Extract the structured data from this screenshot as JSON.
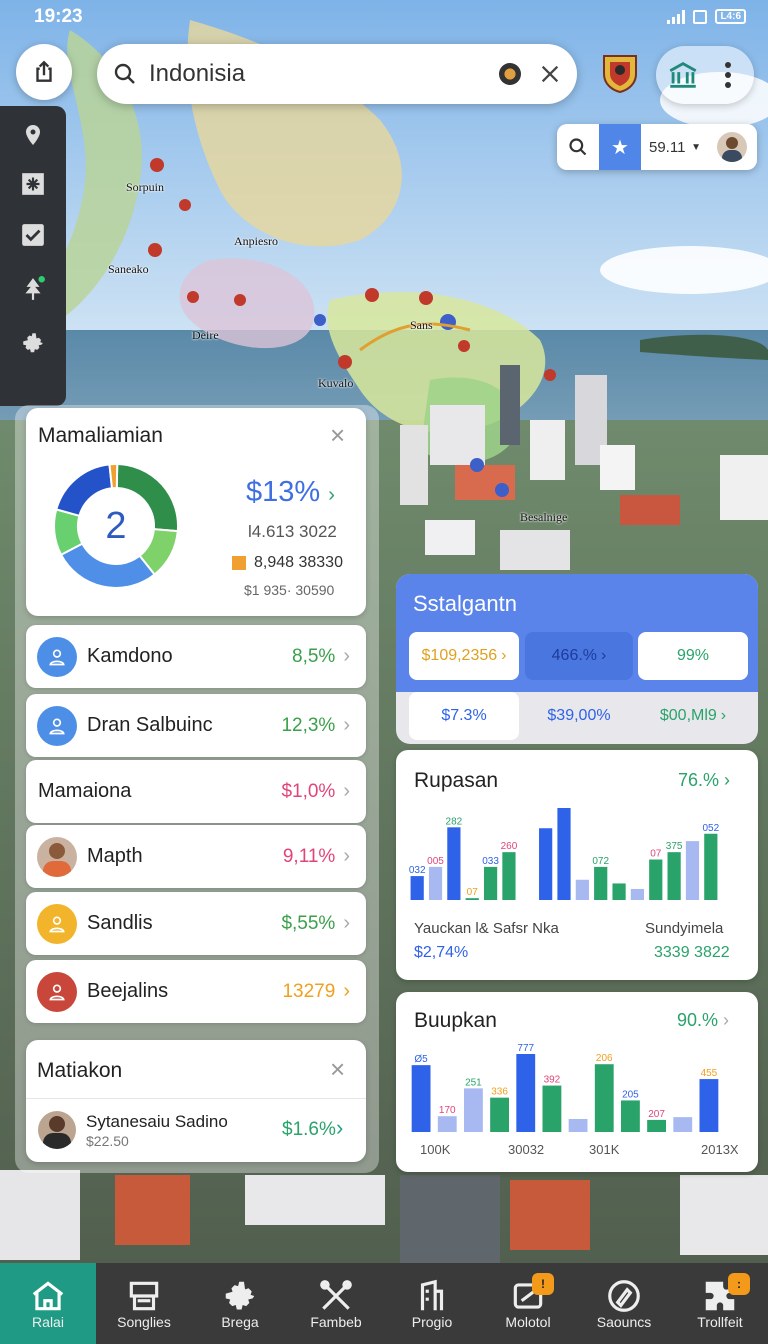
{
  "status": {
    "time": "19:23",
    "battery": "L4:6"
  },
  "search": {
    "value": "Indonisia"
  },
  "mini_toolbar": {
    "value": "59.11"
  },
  "map_labels": [
    "Sorpuin",
    "Anpiesro",
    "Saneako",
    "Deire",
    "Sans",
    "Kuvalo",
    "Besalnige"
  ],
  "summary_card": {
    "title": "Mamaliamian",
    "donut_center": "2",
    "percent": "$13%",
    "line1": "l4.613 3022",
    "line2": "8,948 38330",
    "line3": "$1 935· 30590"
  },
  "donut": {
    "segments": [
      {
        "value": 26,
        "color": "#2f8f4a"
      },
      {
        "value": 13,
        "color": "#7fd26a"
      },
      {
        "value": 28,
        "color": "#4f8fe8"
      },
      {
        "value": 12,
        "color": "#69d06f"
      },
      {
        "value": 19,
        "color": "#2452c8"
      },
      {
        "value": 2,
        "color": "#f0a030"
      }
    ]
  },
  "rows": [
    {
      "name": "Kamdono",
      "value": "8,5%",
      "color": "#3aa04a"
    },
    {
      "name": "Dran Salbuinc",
      "value": "12,3%",
      "color": "#3aa04a"
    },
    {
      "name": "Mamaiona",
      "value": "$1,0%",
      "color": "#e0457a"
    },
    {
      "name": "Mapth",
      "value": "9,11%",
      "color": "#e0457a"
    },
    {
      "name": "Sandlis",
      "value": "$,55%",
      "color": "#3aa04a"
    },
    {
      "name": "Beejalins",
      "value": "13279",
      "color": "#f0a020"
    }
  ],
  "bottom_card": {
    "title": "Matiakon",
    "person_name": "Sytanesaiu Sadino",
    "person_sub": "$22.50",
    "value": "$1.6%"
  },
  "stats": {
    "title": "Sstalgantn",
    "row1": [
      "$109,2356",
      "466.%",
      "99%"
    ],
    "row2": [
      "$7.3%",
      "$39,00%",
      "$00,Ml9"
    ]
  },
  "chart1": {
    "title": "Rupasan",
    "percent": "76.% ",
    "footer_left": "Yauckan l& Safsr Nka",
    "footer_left_value": "$2,74%",
    "footer_right": "Sundyimela",
    "footer_right_value": "3339 3822"
  },
  "chart2": {
    "title": "Buupkan",
    "percent": "90.%",
    "x_labels": [
      "100K",
      "30032",
      "301K",
      "2013X"
    ]
  },
  "chart_data": [
    {
      "type": "bar",
      "title": "Rupasan",
      "values": [
        26,
        36,
        79,
        2,
        36,
        52,
        2,
        78,
        100,
        22,
        36,
        18,
        12,
        44,
        52,
        64,
        72
      ],
      "labels": [
        "032",
        "005",
        "282",
        "07",
        "033",
        "260",
        "",
        "",
        "",
        "",
        "072",
        "",
        "",
        "07",
        "375",
        "",
        "052"
      ],
      "colors": [
        "#2e62e8",
        "#a8b8f0",
        "#2e62e8",
        "#2aa36b",
        "#2aa36b",
        "#2aa36b",
        "#ffffff",
        "#2e62e8",
        "#2e62e8",
        "#a8b8f0",
        "#2aa36b",
        "#2aa36b",
        "#a8b8f0",
        "#2aa36b",
        "#2aa36b",
        "#a8b8f0",
        "#2aa36b"
      ]
    },
    {
      "type": "bar",
      "title": "Buupkan",
      "values": [
        72,
        17,
        47,
        37,
        84,
        50,
        14,
        73,
        34,
        13,
        16,
        57
      ],
      "labels": [
        "Ø5",
        "170",
        "251",
        "336",
        "777",
        "392",
        "",
        "206",
        "205",
        "207",
        "",
        "455"
      ],
      "colors": [
        "#2e62e8",
        "#a8b8f0",
        "#a8b8f0",
        "#2aa36b",
        "#2e62e8",
        "#2aa36b",
        "#a8b8f0",
        "#2aa36b",
        "#2aa36b",
        "#2aa36b",
        "#a8b8f0",
        "#2e62e8"
      ]
    }
  ],
  "nav": [
    {
      "label": "Ralai",
      "icon": "home-icon"
    },
    {
      "label": "Songlies",
      "icon": "printer-icon"
    },
    {
      "label": "Brega",
      "icon": "cog-icon"
    },
    {
      "label": "Fambeb",
      "icon": "tools-icon"
    },
    {
      "label": "Progio",
      "icon": "building-icon"
    },
    {
      "label": "Molotol",
      "icon": "wallet-icon"
    },
    {
      "label": "Saouncs",
      "icon": "pen-icon"
    },
    {
      "label": "Trollfeit",
      "icon": "puzzle-icon"
    }
  ]
}
